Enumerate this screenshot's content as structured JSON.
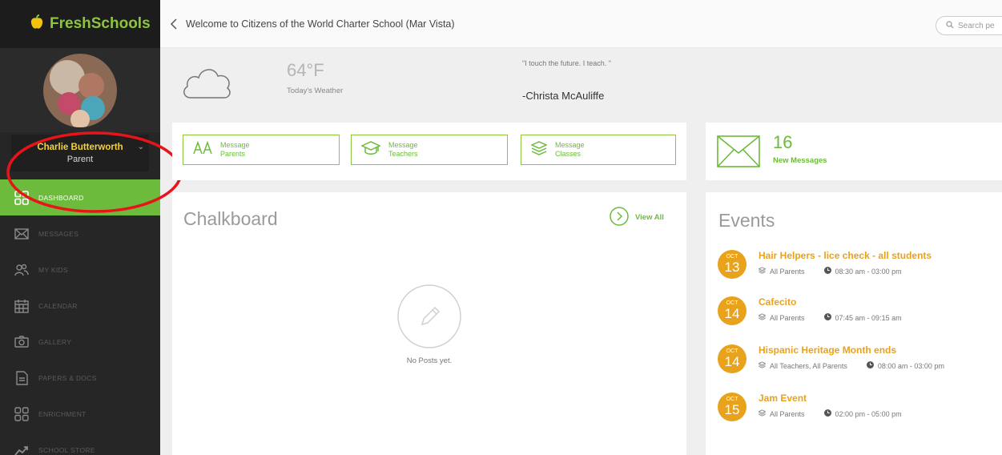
{
  "brand": {
    "name": "FreshSchools"
  },
  "user": {
    "name": "Charlie Butterworth",
    "role": "Parent"
  },
  "nav": [
    {
      "label": "DASHBOARD",
      "icon": "grid-icon",
      "active": true
    },
    {
      "label": "MESSAGES",
      "icon": "envelope-icon"
    },
    {
      "label": "MY KIDS",
      "icon": "people-icon"
    },
    {
      "label": "CALENDAR",
      "icon": "calendar-icon"
    },
    {
      "label": "GALLERY",
      "icon": "camera-icon"
    },
    {
      "label": "PAPERS & DOCS",
      "icon": "document-icon"
    },
    {
      "label": "ENRICHMENT",
      "icon": "grid-icon"
    },
    {
      "label": "SCHOOL STORE",
      "icon": "trend-icon"
    }
  ],
  "header": {
    "title": "Welcome to Citizens of the World Charter School (Mar Vista)",
    "search_placeholder": "Search pe"
  },
  "weather": {
    "temp": "64°F",
    "label": "Today's Weather"
  },
  "quote": {
    "text": "\"I touch the future. I teach. \"",
    "author": "-Christa McAuliffe"
  },
  "actions": [
    {
      "line1": "Message",
      "line2": "Parents"
    },
    {
      "line1": "Message",
      "line2": "Teachers"
    },
    {
      "line1": "Message",
      "line2": "Classes"
    }
  ],
  "new_messages": {
    "count": "16",
    "label": "New Messages"
  },
  "chalkboard": {
    "title": "Chalkboard",
    "view_all": "View All",
    "empty": "No Posts yet."
  },
  "events": {
    "title": "Events",
    "items": [
      {
        "month": "OCT",
        "day": "13",
        "title": "Hair Helpers - lice check - all students",
        "audience": "All Parents",
        "time": "08:30 am - 03:00 pm"
      },
      {
        "month": "OCT",
        "day": "14",
        "title": "Cafecito",
        "audience": "All Parents",
        "time": "07:45 am - 09:15 am"
      },
      {
        "month": "OCT",
        "day": "14",
        "title": "Hispanic Heritage Month ends",
        "audience": "All Teachers, All Parents",
        "time": "08:00 am - 03:00 pm"
      },
      {
        "month": "OCT",
        "day": "15",
        "title": "Jam Event",
        "audience": "All Parents",
        "time": "02:00 pm - 05:00 pm"
      }
    ]
  },
  "colors": {
    "accent": "#6cbb3c",
    "event": "#e9a21b",
    "sidebar": "#262626",
    "annotation": "#e8141a"
  }
}
